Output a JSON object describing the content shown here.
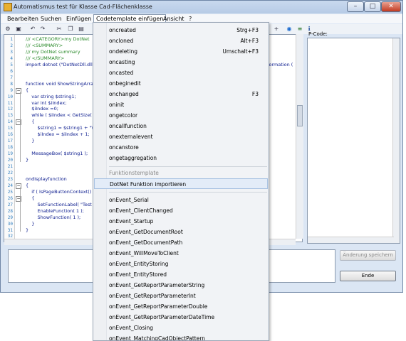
{
  "window": {
    "title": "Automatismus test für Klasse Cad-Flächenklasse"
  },
  "menubar": {
    "items": [
      "Bearbeiten",
      "Suchen",
      "Einfügen",
      "Codetemplate einfügen",
      "Ansicht",
      "?"
    ]
  },
  "editor": {
    "line_numbers": [
      "1",
      "2",
      "3",
      "4",
      "5",
      "6",
      "7",
      "8",
      "9",
      "10",
      "11",
      "12",
      "13",
      "14",
      "15",
      "16",
      "17",
      "18",
      "19",
      "20",
      "21",
      "22",
      "23",
      "24",
      "25",
      "26",
      "27",
      "28",
      "29",
      "30",
      "31",
      "32"
    ],
    "lines": [
      {
        "t": "/// <CATEGORY>my DotNet",
        "c": "com"
      },
      {
        "t": "/// <SUMMARY>",
        "c": "com"
      },
      {
        "t": "/// my DotNet summary",
        "c": "com"
      },
      {
        "t": "/// </SUMMARY>",
        "c": "com"
      },
      {
        "t": "import dotnet (\"DotNetDll.dll\",",
        "c": "pl"
      },
      {
        "t": "",
        "c": "pl"
      },
      {
        "t": "",
        "c": "pl"
      },
      {
        "t": "function void ShowStringArray",
        "c": "pl"
      },
      {
        "t": "{",
        "c": "pl"
      },
      {
        "t": "    var string $string1;",
        "c": "pl"
      },
      {
        "t": "    var int $iIndex;",
        "c": "pl"
      },
      {
        "t": "    $iIndex =0;",
        "c": "pl"
      },
      {
        "t": "    while ( $iIndex < GetSize( $",
        "c": "pl"
      },
      {
        "t": "    {",
        "c": "pl"
      },
      {
        "t": "        $string1 = $string1 + \"\\n\"",
        "c": "pl"
      },
      {
        "t": "        $iIndex = $iIndex + 1;",
        "c": "pl"
      },
      {
        "t": "    }",
        "c": "pl"
      },
      {
        "t": "",
        "c": "pl"
      },
      {
        "t": "    MessageBox( $string1 );",
        "c": "pl"
      },
      {
        "t": "}",
        "c": "pl"
      },
      {
        "t": "",
        "c": "pl"
      },
      {
        "t": "",
        "c": "pl"
      },
      {
        "t": "ondisplayfunction",
        "c": "pl"
      },
      {
        "t": "{",
        "c": "pl"
      },
      {
        "t": "    if ( IsPageButtonContext() )",
        "c": "pl"
      },
      {
        "t": "    {",
        "c": "pl"
      },
      {
        "t": "        SetFunctionLabel( \"Test",
        "c": "pl"
      },
      {
        "t": "        EnableFunction( 1 );",
        "c": "pl"
      },
      {
        "t": "        ShowFunction( 1 );",
        "c": "pl"
      },
      {
        "t": "    }",
        "c": "pl"
      },
      {
        "t": "}",
        "c": "pl"
      },
      {
        "t": "",
        "c": "pl"
      }
    ],
    "partial_right_text": "nformation ("
  },
  "pcode": {
    "label": "P-Code:"
  },
  "buttons": {
    "save_label": "Änderung speichern",
    "end_label": "Ende"
  },
  "dropdown": {
    "items": [
      {
        "label": "oncreated",
        "shortcut": "Strg+F3"
      },
      {
        "label": "oncloned",
        "shortcut": "Alt+F3"
      },
      {
        "label": "ondeleting",
        "shortcut": "Umschalt+F3"
      },
      {
        "label": "oncasting",
        "shortcut": ""
      },
      {
        "label": "oncasted",
        "shortcut": ""
      },
      {
        "label": "onbeginedit",
        "shortcut": ""
      },
      {
        "label": "onchanged",
        "shortcut": "F3"
      },
      {
        "label": "oninit",
        "shortcut": ""
      },
      {
        "label": "ongetcolor",
        "shortcut": ""
      },
      {
        "label": "oncallfunction",
        "shortcut": ""
      },
      {
        "label": "onexternalevent",
        "shortcut": ""
      },
      {
        "label": "oncanstore",
        "shortcut": ""
      },
      {
        "label": "ongetaggregation",
        "shortcut": ""
      }
    ],
    "section_header": "Funktionstemplate",
    "highlighted_item": "DotNet Funktion importieren",
    "event_items": [
      "onEvent_Serial",
      "onEvent_ClientChanged",
      "onEvent_Startup",
      "onEvent_GetDocumentRoot",
      "onEvent_GetDocumentPath",
      "onEvent_WillMoveToClient",
      "onEvent_EntityStoring",
      "onEvent_EntityStored",
      "onEvent_GetReportParameterString",
      "onEvent_GetReportParameterInt",
      "onEvent_GetReportParameterDouble",
      "onEvent_GetReportParameterDateTime",
      "onEvent_Closing",
      "onEvent_MatchingCadObjectPattern"
    ]
  }
}
